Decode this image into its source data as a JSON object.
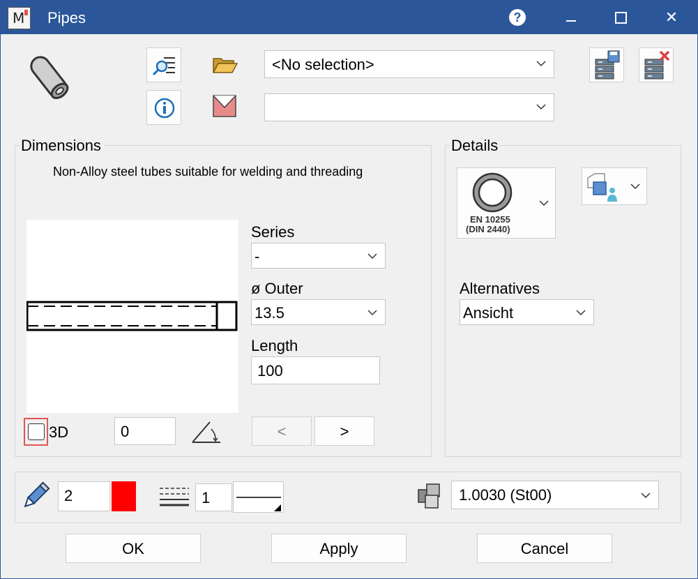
{
  "window": {
    "title": "Pipes",
    "help_symbol": "?",
    "close_symbol": "✕"
  },
  "top": {
    "selection_value": "<No selection>",
    "second_value": ""
  },
  "dimensions": {
    "group_label": "Dimensions",
    "description": "Non-Alloy steel tubes suitable for welding and threading",
    "series_label": "Series",
    "series_value": "-",
    "outer_label": "ø Outer",
    "outer_value": "13.5",
    "length_label": "Length",
    "length_value": "100",
    "threed_label": "3D",
    "angle_value": "0",
    "prev_label": "<",
    "next_label": ">"
  },
  "details": {
    "group_label": "Details",
    "standard_line1": "EN 10255",
    "standard_line2": "(DIN 2440)",
    "alternatives_label": "Alternatives",
    "alternatives_value": "Ansicht"
  },
  "properties": {
    "pen_value": "2",
    "pen_color": "#ff0000",
    "line_width_value": "1",
    "material_value": "1.0030 (St00)"
  },
  "buttons": {
    "ok": "OK",
    "apply": "Apply",
    "cancel": "Cancel"
  },
  "colors": {
    "titlebar": "#2b579a",
    "checkbox_highlight": "#e05555",
    "pen_color": "#ff0000"
  }
}
